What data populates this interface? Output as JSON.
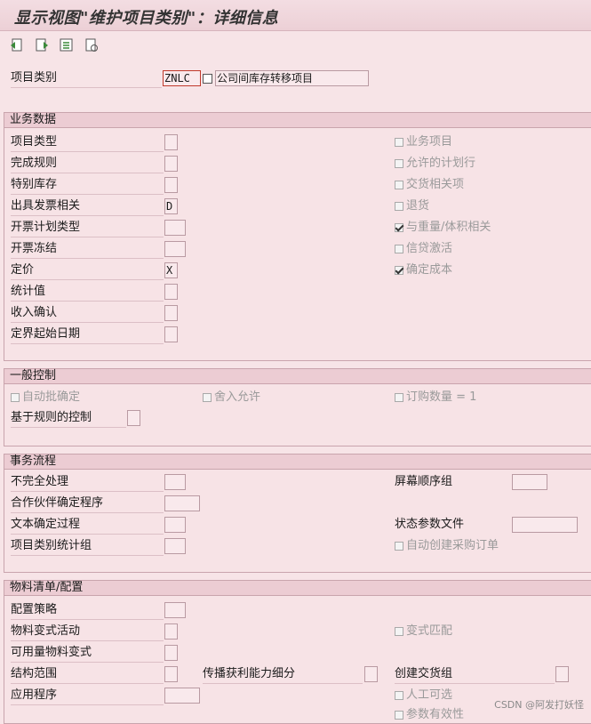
{
  "title": "显示视图\"维护项目类别\"：详细信息",
  "toolbar": [
    "prev-entry-icon",
    "next-entry-icon",
    "select-icon",
    "other-entry-icon"
  ],
  "header": {
    "label": "项目类别",
    "code": "ZNLC",
    "desc": "公司间库存转移项目"
  },
  "business": {
    "heading": "业务数据",
    "rows": [
      {
        "label": "项目类型",
        "value": ""
      },
      {
        "label": "完成规则",
        "value": ""
      },
      {
        "label": "特别库存",
        "value": ""
      },
      {
        "label": "出具发票相关",
        "value": "D"
      },
      {
        "label": "开票计划类型",
        "value": ""
      },
      {
        "label": "开票冻结",
        "value": ""
      },
      {
        "label": "定价",
        "value": "X"
      },
      {
        "label": "统计值",
        "value": ""
      },
      {
        "label": "收入确认",
        "value": ""
      },
      {
        "label": "定界起始日期",
        "value": ""
      }
    ],
    "checks": [
      {
        "label": "业务项目",
        "checked": false
      },
      {
        "label": "允许的计划行",
        "checked": false
      },
      {
        "label": "交货相关项",
        "checked": false
      },
      {
        "label": "退货",
        "checked": false
      },
      {
        "label": "与重量/体积相关",
        "checked": true
      },
      {
        "label": "信贷激活",
        "checked": false
      },
      {
        "label": "确定成本",
        "checked": true
      }
    ]
  },
  "general": {
    "heading": "一般控制",
    "checks": [
      {
        "label": "自动批确定",
        "checked": false
      },
      {
        "label": "舍入允许",
        "checked": false
      },
      {
        "label": "订购数量 = 1",
        "checked": false
      }
    ],
    "rule_label": "基于规则的控制"
  },
  "flow": {
    "heading": "事务流程",
    "rows": [
      "不完全处理",
      "合作伙伴确定程序",
      "文本确定过程",
      "项目类别统计组"
    ],
    "screen_seq": "屏幕顺序组",
    "status_profile": "状态参数文件",
    "auto_po": "自动创建采购订单"
  },
  "bom": {
    "heading": "物料清单/配置",
    "rows": [
      "配置策略",
      "物料变式活动",
      "可用量物料变式",
      "结构范围",
      "应用程序"
    ],
    "variant_match": "变式匹配",
    "atp_label": "传播获利能力细分",
    "delivery_group": "创建交货组",
    "manual_alt": "人工可选",
    "param_eff": "参数有效性"
  },
  "watermark": "CSDN @阿发打妖怪"
}
